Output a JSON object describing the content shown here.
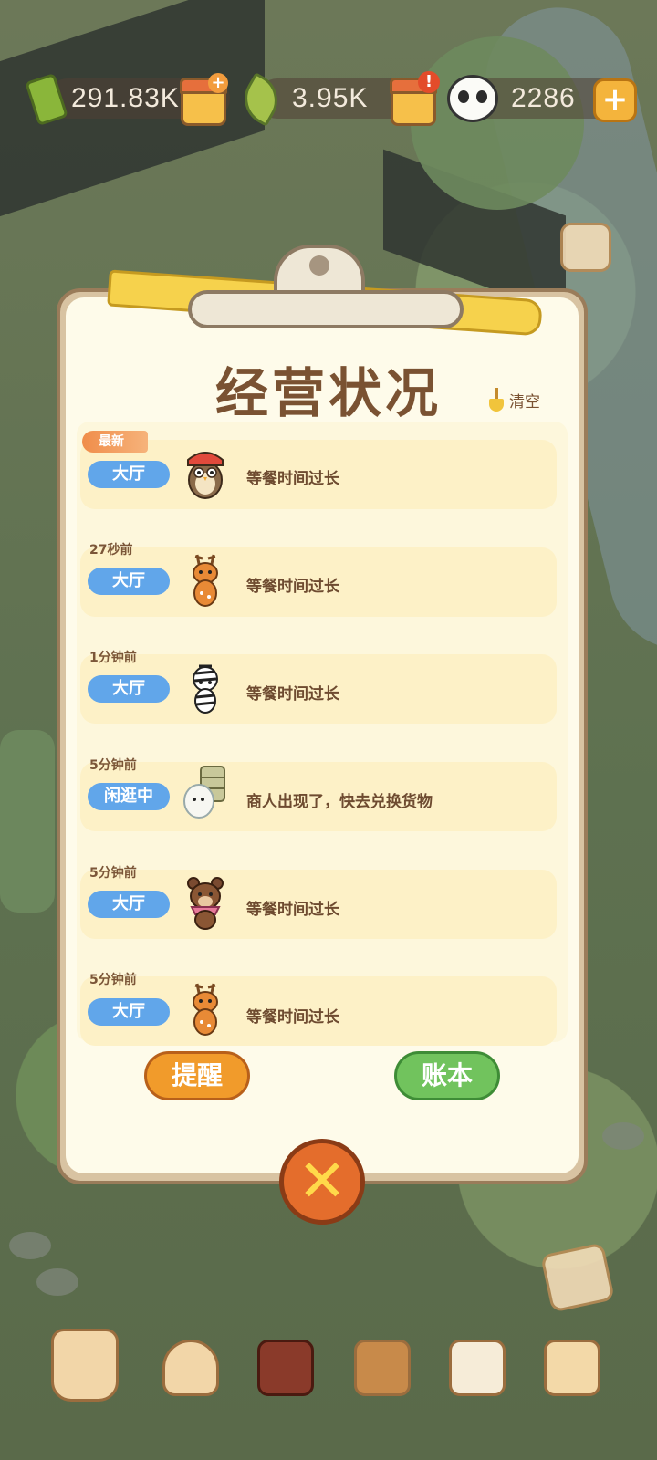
{
  "resources": {
    "bamboo": "291.83K",
    "leaves": "3.95K",
    "panda_coins": "2286"
  },
  "panel": {
    "title": "经营状况",
    "clear_label": "清空",
    "new_badge": "最新",
    "entries": [
      {
        "time": "",
        "location": "大厅",
        "avatar": "owl-customer-icon",
        "message": "等餐时间过长"
      },
      {
        "time": "27秒前",
        "location": "大厅",
        "avatar": "deer-customer-icon",
        "message": "等餐时间过长"
      },
      {
        "time": "1分钟前",
        "location": "大厅",
        "avatar": "zebra-customer-icon",
        "message": "等餐时间过长"
      },
      {
        "time": "5分钟前",
        "location": "闲逛中",
        "avatar": "merchant-icon",
        "message": "商人出现了，快去兑换货物"
      },
      {
        "time": "5分钟前",
        "location": "大厅",
        "avatar": "bear-customer-icon",
        "message": "等餐时间过长"
      },
      {
        "time": "5分钟前",
        "location": "大厅",
        "avatar": "deer-customer-icon",
        "message": "等餐时间过长"
      }
    ],
    "remind_label": "提醒",
    "ledger_label": "账本"
  },
  "colors": {
    "tag_blue": "#61a6ea",
    "remind_orange": "#f19b2b",
    "ledger_green": "#71c35d",
    "title_brown": "#7a5232"
  }
}
